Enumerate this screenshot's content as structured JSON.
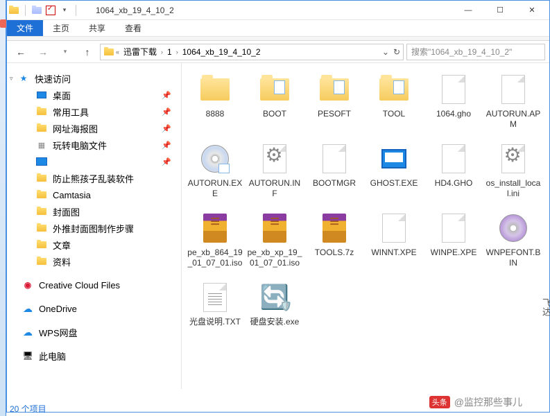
{
  "window": {
    "title": "1064_xb_19_4_10_2"
  },
  "ribbon": {
    "file": "文件",
    "home": "主页",
    "share": "共享",
    "view": "查看"
  },
  "breadcrumb": {
    "sep": "«",
    "b1": "迅雷下载",
    "b2": "1",
    "b3": "1064_xb_19_4_10_2"
  },
  "search": {
    "placeholder": "搜索\"1064_xb_19_4_10_2\""
  },
  "nav": {
    "quick": "快速访问",
    "items": [
      {
        "label": "桌面",
        "pin": true,
        "ico": "desktop"
      },
      {
        "label": "常用工具",
        "pin": true,
        "ico": "folder"
      },
      {
        "label": "网址海报图",
        "pin": true,
        "ico": "folder"
      },
      {
        "label": "玩转电脑文件",
        "pin": true,
        "ico": "grid"
      },
      {
        "label": "",
        "pin": true,
        "ico": "video"
      },
      {
        "label": "防止熊孩子乱装软件",
        "pin": false,
        "ico": "folder"
      },
      {
        "label": "Camtasia",
        "pin": false,
        "ico": "folder"
      },
      {
        "label": "封面图",
        "pin": false,
        "ico": "folder"
      },
      {
        "label": "外推封面图制作步骤",
        "pin": false,
        "ico": "folder"
      },
      {
        "label": "文章",
        "pin": false,
        "ico": "folder"
      },
      {
        "label": "资料",
        "pin": false,
        "ico": "folder"
      }
    ],
    "cc": "Creative Cloud Files",
    "onedrive": "OneDrive",
    "wps": "WPS网盘",
    "thispc": "此电脑"
  },
  "files": [
    {
      "name": "8888",
      "type": "folder"
    },
    {
      "name": "BOOT",
      "type": "folder-doc"
    },
    {
      "name": "PESOFT",
      "type": "folder-doc"
    },
    {
      "name": "TOOL",
      "type": "folder-doc"
    },
    {
      "name": "1064.gho",
      "type": "file"
    },
    {
      "name": "AUTORUN.APM",
      "type": "file"
    },
    {
      "name": "AUTORUN.EXE",
      "type": "disc"
    },
    {
      "name": "AUTORUN.INF",
      "type": "gear"
    },
    {
      "name": "BOOTMGR",
      "type": "file"
    },
    {
      "name": "GHOST.EXE",
      "type": "ghost"
    },
    {
      "name": "HD4.GHO",
      "type": "file"
    },
    {
      "name": "os_install_local.ini",
      "type": "gear"
    },
    {
      "name": "pe_xb_864_19_01_07_01.iso",
      "type": "rar"
    },
    {
      "name": "pe_xb_xp_19_01_07_01.iso",
      "type": "rar"
    },
    {
      "name": "TOOLS.7z",
      "type": "rar"
    },
    {
      "name": "WINNT.XPE",
      "type": "file"
    },
    {
      "name": "WINPE.XPE",
      "type": "file"
    },
    {
      "name": "WNPEFONT.BIN",
      "type": "disc-purple"
    },
    {
      "name": "光盘说明.TXT",
      "type": "txt"
    },
    {
      "name": "硬盘安装.exe",
      "type": "shield"
    }
  ],
  "status": "20 个项目",
  "watermark": {
    "badge": "头条",
    "text": "@监控那些事儿"
  },
  "sidechars": "飞达"
}
